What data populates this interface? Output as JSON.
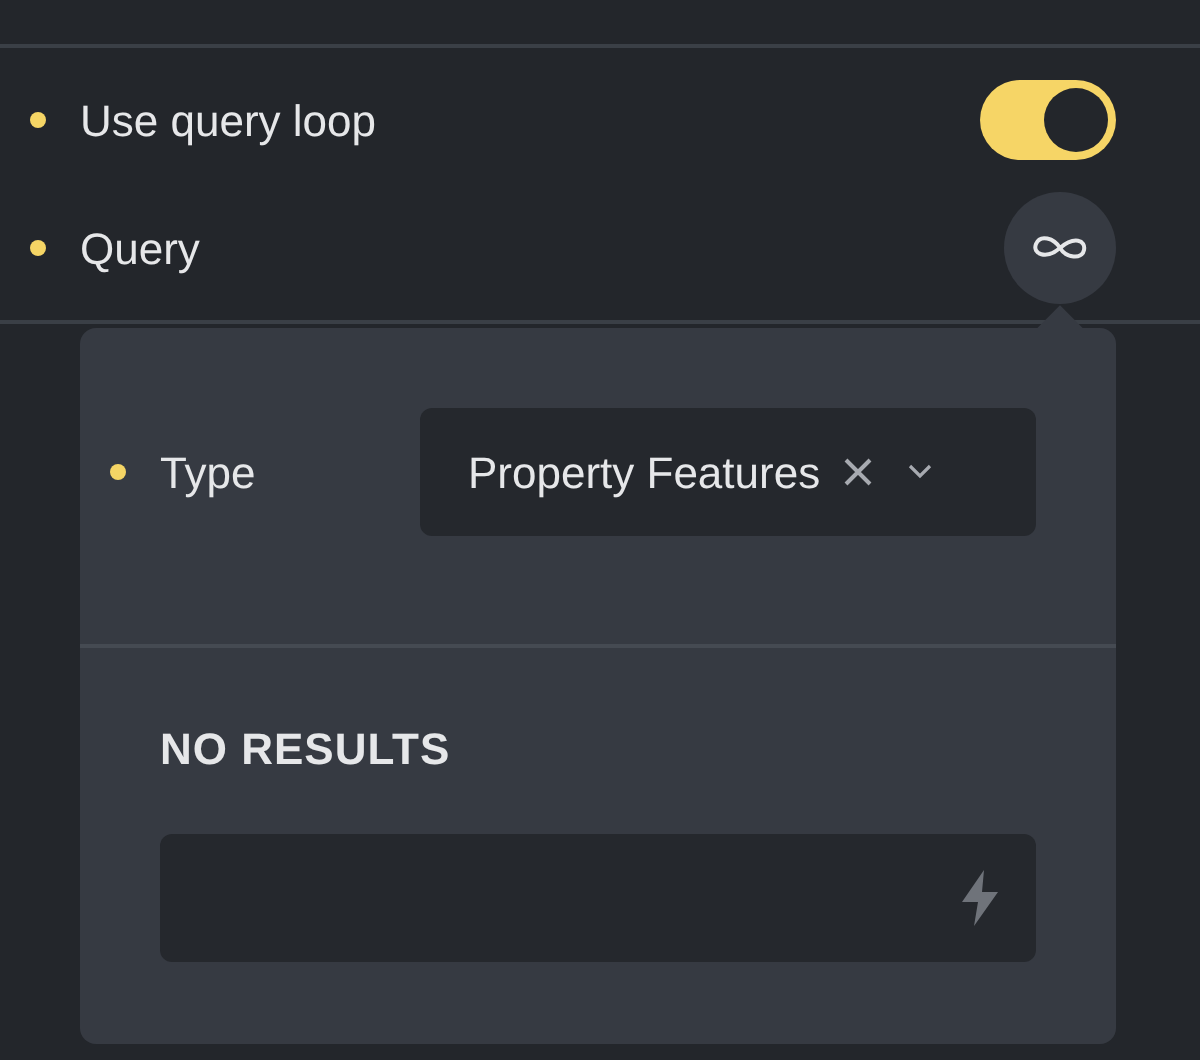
{
  "controls": [
    {
      "kind": "toggle",
      "label": "Use query loop",
      "on": true
    },
    {
      "kind": "query",
      "label": "Query",
      "expanded": true
    }
  ],
  "query_popup": {
    "type_label": "Type",
    "type_value": "Property Features",
    "results_heading": "NO RESULTS"
  }
}
